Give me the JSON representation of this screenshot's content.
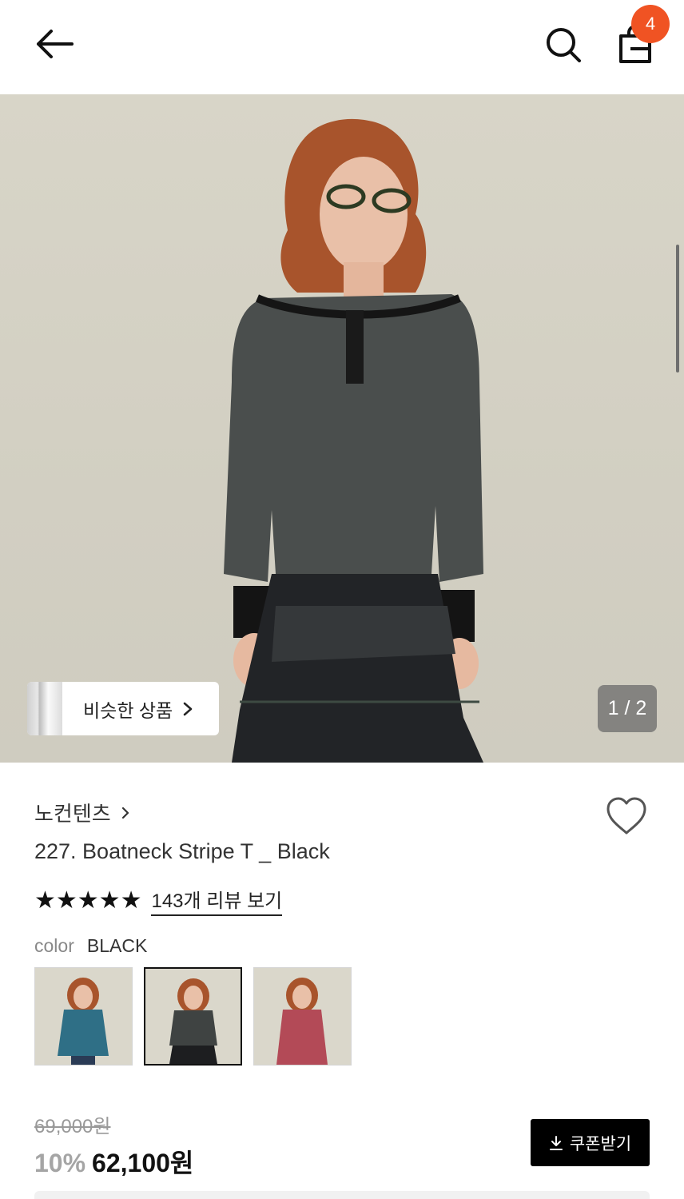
{
  "header": {
    "cart_count": "4",
    "icons": {
      "back": "arrow-left-icon",
      "search": "search-icon",
      "bag": "shopping-bag-icon"
    },
    "badge_color": "#f05323"
  },
  "hero": {
    "page_indicator": "1 / 2",
    "similar_label": "비슷한 상품"
  },
  "product": {
    "brand": "노컨텐츠",
    "title": "227. Boatneck Stripe T _ Black",
    "stars": "★★★★★",
    "rating": 5,
    "review_link": "143개 리뷰 보기",
    "color_label": "color",
    "color_value": "BLACK",
    "swatches": [
      {
        "color_name": "teal",
        "top_color": "#2f6f86"
      },
      {
        "color_name": "black",
        "top_color": "#3f4342",
        "selected": true
      },
      {
        "color_name": "red",
        "top_color": "#b34a57"
      }
    ]
  },
  "price": {
    "original": "69,000원",
    "discount": "10%",
    "sale": "62,100원",
    "coupon_label": "쿠폰받기"
  }
}
